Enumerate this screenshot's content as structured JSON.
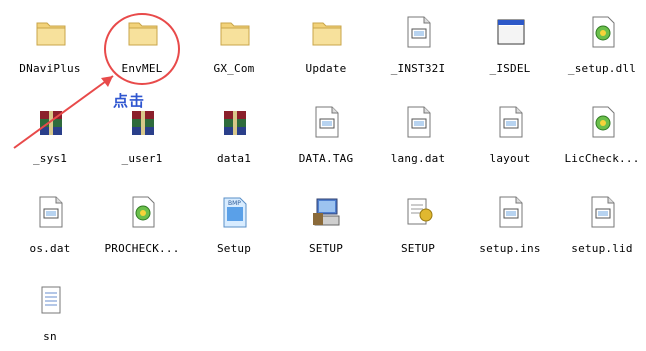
{
  "colors": {
    "annotation_red": "#e84a4a",
    "annotation_blue": "#2f56d0",
    "folder": "#f2d27a"
  },
  "annotation": {
    "label": "点击"
  },
  "files": [
    {
      "name": "DNaviPlus",
      "icon": "folder-icon"
    },
    {
      "name": "EnvMEL",
      "icon": "folder-icon"
    },
    {
      "name": "GX_Com",
      "icon": "folder-icon"
    },
    {
      "name": "Update",
      "icon": "folder-icon"
    },
    {
      "name": "_INST32I",
      "icon": "file-icon"
    },
    {
      "name": "_ISDEL",
      "icon": "exe-window-icon"
    },
    {
      "name": "_setup.dll",
      "icon": "dll-icon"
    },
    {
      "name": "_sys1",
      "icon": "archive-icon"
    },
    {
      "name": "_user1",
      "icon": "archive-icon"
    },
    {
      "name": "data1",
      "icon": "archive-icon"
    },
    {
      "name": "DATA.TAG",
      "icon": "file-icon"
    },
    {
      "name": "lang.dat",
      "icon": "file-icon"
    },
    {
      "name": "layout",
      "icon": "file-icon"
    },
    {
      "name": "LicCheck...",
      "icon": "dll-icon"
    },
    {
      "name": "os.dat",
      "icon": "file-icon"
    },
    {
      "name": "PROCHECK...",
      "icon": "dll-icon"
    },
    {
      "name": "Setup",
      "icon": "bmp-icon"
    },
    {
      "name": "SETUP",
      "icon": "setup-computer-icon"
    },
    {
      "name": "SETUP",
      "icon": "setup-notepad-icon"
    },
    {
      "name": "setup.ins",
      "icon": "file-icon"
    },
    {
      "name": "setup.lid",
      "icon": "file-icon"
    },
    {
      "name": "sn",
      "icon": "text-file-icon"
    }
  ]
}
